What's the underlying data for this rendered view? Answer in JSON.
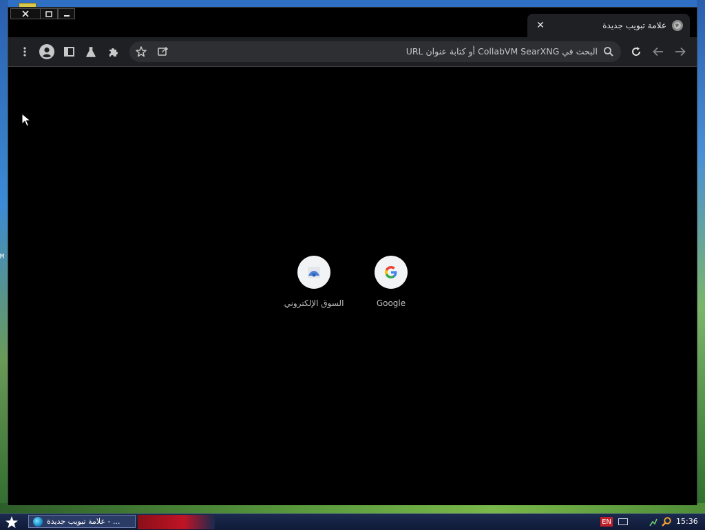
{
  "window": {
    "controls": {
      "close": "close",
      "maximize": "maximize",
      "minimize": "minimize"
    }
  },
  "tab": {
    "title": "علامة تبويب جديدة",
    "close_glyph": "✕"
  },
  "toolbar": {
    "omnibox_placeholder": "البحث في CollabVM SearXNG أو كتابة عنوان URL",
    "icons": [
      "back-icon",
      "forward-icon",
      "reload-icon",
      "search-icon",
      "share-icon",
      "bookmark-star-icon",
      "extensions-icon",
      "labs-icon",
      "side-panel-icon",
      "profile-icon",
      "menu-icon"
    ]
  },
  "shortcuts": [
    {
      "label": "Google",
      "icon": "google-icon"
    },
    {
      "label": "السوق الإلكتروني",
      "icon": "web-store-icon"
    }
  ],
  "desktop": {
    "edge_label": "M"
  },
  "taskbar": {
    "task_label": "علامة تبويب جديدة - ...",
    "language": "EN",
    "clock": "15:36"
  },
  "colors": {
    "window_bg": "#000000",
    "toolbar_bg": "#1f2023",
    "omnibox_bg": "#2e2f32",
    "taskbar_bg": "#14213f",
    "language_badge": "#c0202a"
  }
}
